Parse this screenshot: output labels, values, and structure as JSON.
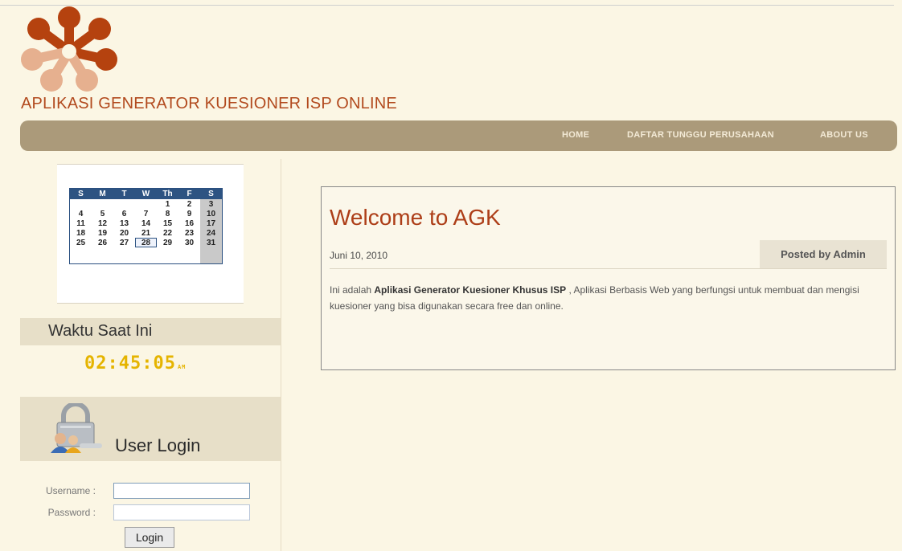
{
  "header": {
    "site_title": "APLIKASI GENERATOR KUESIONER ISP ONLINE",
    "logo_colors": {
      "dark": "#b5420f",
      "light": "#e6b08f"
    }
  },
  "nav": {
    "items": [
      "HOME",
      "DAFTAR TUNGGU PERUSAHAAN",
      "ABOUT US"
    ]
  },
  "calendar": {
    "weekdays": [
      "S",
      "M",
      "T",
      "W",
      "Th",
      "F",
      "S"
    ],
    "weeks": [
      [
        "",
        "",
        "",
        "",
        "1",
        "2",
        "3"
      ],
      [
        "4",
        "5",
        "6",
        "7",
        "8",
        "9",
        "10"
      ],
      [
        "11",
        "12",
        "13",
        "14",
        "15",
        "16",
        "17"
      ],
      [
        "18",
        "19",
        "20",
        "21",
        "22",
        "23",
        "24"
      ],
      [
        "25",
        "26",
        "27",
        "28",
        "29",
        "30",
        "31"
      ]
    ],
    "today": "28"
  },
  "clock": {
    "title": "Waktu Saat Ini",
    "time": "02:45:05",
    "ampm": "AM"
  },
  "login": {
    "title": "User Login",
    "username_label": "Username :",
    "password_label": "Password :",
    "username_value": "",
    "password_value": "",
    "button_label": "Login"
  },
  "post": {
    "title": "Welcome to AGK",
    "date": "Juni 10, 2010",
    "author": "Posted by Admin",
    "body_intro": "Ini adalah ",
    "body_bold": "Aplikasi Generator Kuesioner Khusus ISP",
    "body_rest": " , Aplikasi Berbasis Web yang berfungsi untuk membuat dan mengisi kuesioner yang bisa digunakan secara free dan online."
  }
}
